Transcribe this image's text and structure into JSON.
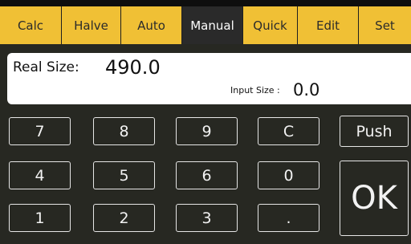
{
  "tabs": [
    {
      "label": "Calc"
    },
    {
      "label": "Halve"
    },
    {
      "label": "Auto"
    },
    {
      "label": "Manual"
    },
    {
      "label": "Quick"
    },
    {
      "label": "Edit"
    },
    {
      "label": "Set"
    }
  ],
  "display": {
    "real_size_label": "Real Size:",
    "real_size_value": "490.0",
    "input_size_label": "Input Size :",
    "input_size_value": "0.0"
  },
  "keypad": {
    "k7": "7",
    "k8": "8",
    "k9": "9",
    "clear": "C",
    "k4": "4",
    "k5": "5",
    "k6": "6",
    "k0": "0",
    "k1": "1",
    "k2": "2",
    "k3": "3",
    "dot": ".",
    "push": "Push",
    "ok": "OK"
  },
  "colors": {
    "tab_yellow": "#f0c035",
    "tab_active": "#2a2a2a",
    "background": "#272822",
    "panel": "#ffffff"
  }
}
